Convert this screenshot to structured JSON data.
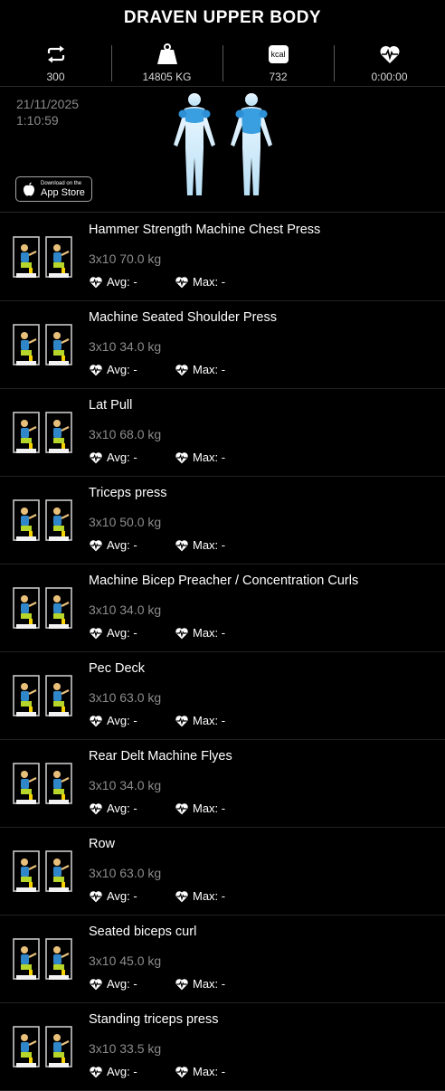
{
  "header": {
    "title": "DRAVEN UPPER BODY"
  },
  "stats": [
    {
      "icon": "repeat-icon",
      "value": "300"
    },
    {
      "icon": "weight-icon",
      "value": "14805 KG"
    },
    {
      "icon": "kcal-icon",
      "label": "kcal",
      "value": "732"
    },
    {
      "icon": "heart-rate-icon",
      "value": "0:00:00"
    }
  ],
  "workout": {
    "date": "21/11/2025",
    "time": "1:10:59"
  },
  "app_store": {
    "small": "Download on the",
    "big": "App Store"
  },
  "heart": {
    "avg_label": "Avg: -",
    "max_label": "Max: -"
  },
  "exercises": [
    {
      "name": "Hammer Strength Machine Chest Press",
      "sets": "3x10 70.0 kg"
    },
    {
      "name": "Machine Seated Shoulder Press",
      "sets": "3x10 34.0 kg"
    },
    {
      "name": "Lat Pull",
      "sets": "3x10 68.0 kg"
    },
    {
      "name": "Triceps press",
      "sets": "3x10 50.0 kg"
    },
    {
      "name": "Machine Bicep Preacher / Concentration Curls",
      "sets": "3x10 34.0 kg"
    },
    {
      "name": "Pec Deck",
      "sets": "3x10 63.0 kg"
    },
    {
      "name": "Rear Delt Machine Flyes",
      "sets": "3x10 34.0 kg"
    },
    {
      "name": "Row",
      "sets": "3x10 63.0 kg"
    },
    {
      "name": "Seated biceps curl",
      "sets": "3x10 45.0 kg"
    },
    {
      "name": "Standing triceps press",
      "sets": "3x10 33.5 kg"
    }
  ]
}
